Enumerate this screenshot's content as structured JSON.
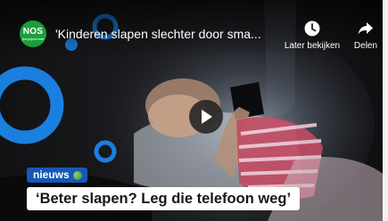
{
  "video": {
    "title": "'Kinderen slapen slechter door sma...",
    "channel_logo": {
      "name": "NOS",
      "sub": "jeugdjournaal"
    },
    "actions": {
      "watch_later": {
        "label": "Later bekijken",
        "icon": "clock-icon"
      },
      "share": {
        "label": "Delen",
        "icon": "share-arrow-icon"
      }
    },
    "overlay": {
      "tag": "nieuws",
      "headline": "‘Beter slapen? Leg die telefoon weg’"
    }
  },
  "colors": {
    "logo_green": "#1a9f3a",
    "tag_blue": "#1558b6",
    "ring_blue": "#1b7fe0"
  }
}
